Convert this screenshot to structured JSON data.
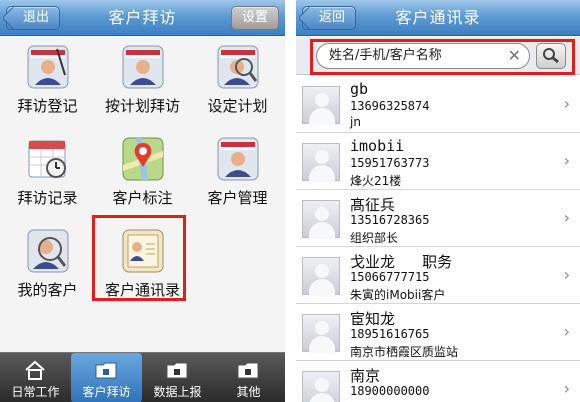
{
  "left": {
    "header": {
      "back_label": "退出",
      "title": "客户拜访",
      "settings_label": "设置"
    },
    "grid": [
      {
        "label": "拜访登记",
        "icon": "visit-register-icon"
      },
      {
        "label": "按计划拜访",
        "icon": "planned-visit-icon"
      },
      {
        "label": "设定计划",
        "icon": "set-plan-icon"
      },
      {
        "label": "拜访记录",
        "icon": "visit-record-icon"
      },
      {
        "label": "客户标注",
        "icon": "map-pin-icon"
      },
      {
        "label": "客户管理",
        "icon": "customer-manage-icon"
      },
      {
        "label": "我的客户",
        "icon": "my-customer-icon"
      },
      {
        "label": "客户通讯录",
        "icon": "contact-book-icon"
      }
    ],
    "tabs": [
      {
        "label": "日常工作",
        "icon": "home-icon",
        "active": false
      },
      {
        "label": "客户拜访",
        "icon": "folder-icon",
        "active": true
      },
      {
        "label": "数据上报",
        "icon": "folder-icon",
        "active": false
      },
      {
        "label": "其他",
        "icon": "folder-icon",
        "active": false
      }
    ]
  },
  "right": {
    "header": {
      "back_label": "返回",
      "title": "客户通讯录"
    },
    "search": {
      "placeholder": "姓名/手机/客户名称"
    },
    "contacts": [
      {
        "name": "gb",
        "phone": "13696325874",
        "note": "jn"
      },
      {
        "name": "imobii",
        "phone": "15951763773",
        "note": "烽火21楼"
      },
      {
        "name": "髙征兵",
        "phone": "13516728365",
        "note": "组织部长"
      },
      {
        "name": "戈业龙   职务",
        "phone": "15066777715",
        "note": "朱寅的iMobii客户"
      },
      {
        "name": "宦知龙",
        "phone": "18951616765",
        "note": "南京市栖霞区质监站"
      },
      {
        "name": "南京",
        "phone": "18900000000",
        "note": ""
      }
    ]
  },
  "colors": {
    "header_blue": "#5f9bd3",
    "highlight_red": "#e21d1d",
    "tabbar_dark": "#2b2b2b",
    "tab_active": "#3f86c9"
  }
}
